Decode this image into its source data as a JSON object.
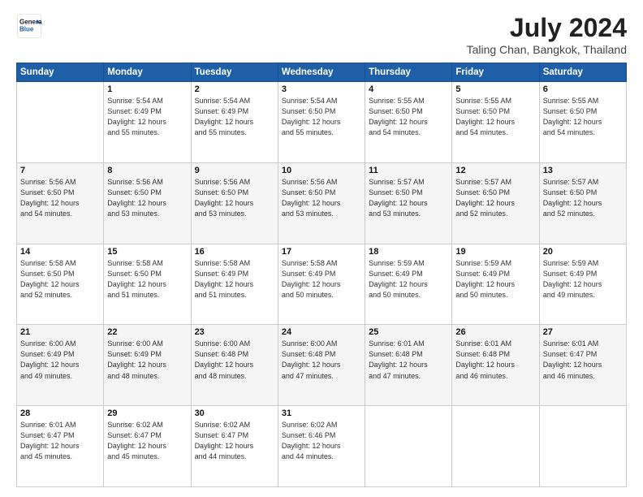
{
  "logo": {
    "line1": "General",
    "line2": "Blue"
  },
  "title": "July 2024",
  "location": "Taling Chan, Bangkok, Thailand",
  "days_of_week": [
    "Sunday",
    "Monday",
    "Tuesday",
    "Wednesday",
    "Thursday",
    "Friday",
    "Saturday"
  ],
  "weeks": [
    [
      {
        "day": "",
        "info": ""
      },
      {
        "day": "1",
        "info": "Sunrise: 5:54 AM\nSunset: 6:49 PM\nDaylight: 12 hours\nand 55 minutes."
      },
      {
        "day": "2",
        "info": "Sunrise: 5:54 AM\nSunset: 6:49 PM\nDaylight: 12 hours\nand 55 minutes."
      },
      {
        "day": "3",
        "info": "Sunrise: 5:54 AM\nSunset: 6:50 PM\nDaylight: 12 hours\nand 55 minutes."
      },
      {
        "day": "4",
        "info": "Sunrise: 5:55 AM\nSunset: 6:50 PM\nDaylight: 12 hours\nand 54 minutes."
      },
      {
        "day": "5",
        "info": "Sunrise: 5:55 AM\nSunset: 6:50 PM\nDaylight: 12 hours\nand 54 minutes."
      },
      {
        "day": "6",
        "info": "Sunrise: 5:55 AM\nSunset: 6:50 PM\nDaylight: 12 hours\nand 54 minutes."
      }
    ],
    [
      {
        "day": "7",
        "info": "Sunrise: 5:56 AM\nSunset: 6:50 PM\nDaylight: 12 hours\nand 54 minutes."
      },
      {
        "day": "8",
        "info": "Sunrise: 5:56 AM\nSunset: 6:50 PM\nDaylight: 12 hours\nand 53 minutes."
      },
      {
        "day": "9",
        "info": "Sunrise: 5:56 AM\nSunset: 6:50 PM\nDaylight: 12 hours\nand 53 minutes."
      },
      {
        "day": "10",
        "info": "Sunrise: 5:56 AM\nSunset: 6:50 PM\nDaylight: 12 hours\nand 53 minutes."
      },
      {
        "day": "11",
        "info": "Sunrise: 5:57 AM\nSunset: 6:50 PM\nDaylight: 12 hours\nand 53 minutes."
      },
      {
        "day": "12",
        "info": "Sunrise: 5:57 AM\nSunset: 6:50 PM\nDaylight: 12 hours\nand 52 minutes."
      },
      {
        "day": "13",
        "info": "Sunrise: 5:57 AM\nSunset: 6:50 PM\nDaylight: 12 hours\nand 52 minutes."
      }
    ],
    [
      {
        "day": "14",
        "info": "Sunrise: 5:58 AM\nSunset: 6:50 PM\nDaylight: 12 hours\nand 52 minutes."
      },
      {
        "day": "15",
        "info": "Sunrise: 5:58 AM\nSunset: 6:50 PM\nDaylight: 12 hours\nand 51 minutes."
      },
      {
        "day": "16",
        "info": "Sunrise: 5:58 AM\nSunset: 6:49 PM\nDaylight: 12 hours\nand 51 minutes."
      },
      {
        "day": "17",
        "info": "Sunrise: 5:58 AM\nSunset: 6:49 PM\nDaylight: 12 hours\nand 50 minutes."
      },
      {
        "day": "18",
        "info": "Sunrise: 5:59 AM\nSunset: 6:49 PM\nDaylight: 12 hours\nand 50 minutes."
      },
      {
        "day": "19",
        "info": "Sunrise: 5:59 AM\nSunset: 6:49 PM\nDaylight: 12 hours\nand 50 minutes."
      },
      {
        "day": "20",
        "info": "Sunrise: 5:59 AM\nSunset: 6:49 PM\nDaylight: 12 hours\nand 49 minutes."
      }
    ],
    [
      {
        "day": "21",
        "info": "Sunrise: 6:00 AM\nSunset: 6:49 PM\nDaylight: 12 hours\nand 49 minutes."
      },
      {
        "day": "22",
        "info": "Sunrise: 6:00 AM\nSunset: 6:49 PM\nDaylight: 12 hours\nand 48 minutes."
      },
      {
        "day": "23",
        "info": "Sunrise: 6:00 AM\nSunset: 6:48 PM\nDaylight: 12 hours\nand 48 minutes."
      },
      {
        "day": "24",
        "info": "Sunrise: 6:00 AM\nSunset: 6:48 PM\nDaylight: 12 hours\nand 47 minutes."
      },
      {
        "day": "25",
        "info": "Sunrise: 6:01 AM\nSunset: 6:48 PM\nDaylight: 12 hours\nand 47 minutes."
      },
      {
        "day": "26",
        "info": "Sunrise: 6:01 AM\nSunset: 6:48 PM\nDaylight: 12 hours\nand 46 minutes."
      },
      {
        "day": "27",
        "info": "Sunrise: 6:01 AM\nSunset: 6:47 PM\nDaylight: 12 hours\nand 46 minutes."
      }
    ],
    [
      {
        "day": "28",
        "info": "Sunrise: 6:01 AM\nSunset: 6:47 PM\nDaylight: 12 hours\nand 45 minutes."
      },
      {
        "day": "29",
        "info": "Sunrise: 6:02 AM\nSunset: 6:47 PM\nDaylight: 12 hours\nand 45 minutes."
      },
      {
        "day": "30",
        "info": "Sunrise: 6:02 AM\nSunset: 6:47 PM\nDaylight: 12 hours\nand 44 minutes."
      },
      {
        "day": "31",
        "info": "Sunrise: 6:02 AM\nSunset: 6:46 PM\nDaylight: 12 hours\nand 44 minutes."
      },
      {
        "day": "",
        "info": ""
      },
      {
        "day": "",
        "info": ""
      },
      {
        "day": "",
        "info": ""
      }
    ]
  ]
}
